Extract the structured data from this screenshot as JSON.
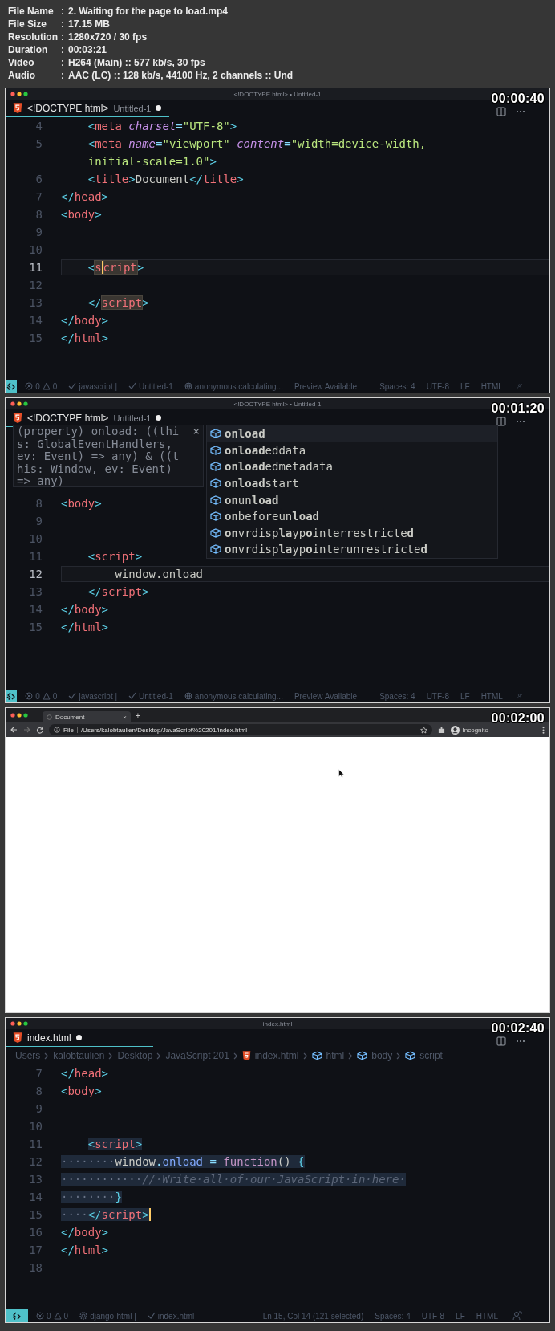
{
  "info": [
    {
      "label": "File Name",
      "sep": ":",
      "value": "2. Waiting for the page to load.mp4"
    },
    {
      "label": "File Size",
      "sep": ":",
      "value": "17.15 MB"
    },
    {
      "label": "Resolution",
      "sep": ":",
      "value": "1280x720 / 30 fps"
    },
    {
      "label": "Duration",
      "sep": ":",
      "value": "00:03:21"
    },
    {
      "label": "Video",
      "sep": ":",
      "value": "H264 (Main) :: 577 kb/s, 30 fps"
    },
    {
      "label": "Audio",
      "sep": ":",
      "value": "AAC (LC) :: 128 kb/s, 44100 Hz, 2 channels :: Und"
    }
  ],
  "frames": [
    {
      "kind": "editor",
      "timestamp": "00:00:40",
      "window_title": "<!DOCTYPE html> • Untitled-1",
      "tab": {
        "label": "<!DOCTYPE html>",
        "description": "Untitled-1",
        "dirty": true
      },
      "lines": [
        {
          "num": "4",
          "tokens": [
            {
              "text": "    <",
              "kind": "p"
            },
            {
              "text": "meta",
              "kind": "tag"
            },
            {
              "text": " charset",
              "kind": "attr"
            },
            {
              "text": "=",
              "kind": "op"
            },
            {
              "text": "\"UTF-8\"",
              "kind": "str"
            },
            {
              "text": ">",
              "kind": "p"
            }
          ]
        },
        {
          "num": "5",
          "tokens": [
            {
              "text": "    <",
              "kind": "p"
            },
            {
              "text": "meta",
              "kind": "tag"
            },
            {
              "text": " name",
              "kind": "attr"
            },
            {
              "text": "=",
              "kind": "op"
            },
            {
              "text": "\"viewport\"",
              "kind": "str"
            },
            {
              "text": " content",
              "kind": "attr"
            },
            {
              "text": "=",
              "kind": "op"
            },
            {
              "text": "\"width=device-width,",
              "kind": "str"
            }
          ]
        },
        {
          "tokens": [
            {
              "text": "    initial-scale=1.0\"",
              "kind": "str"
            },
            {
              "text": ">",
              "kind": "p"
            }
          ]
        },
        {
          "num": "6",
          "tokens": [
            {
              "text": "    <",
              "kind": "p"
            },
            {
              "text": "title",
              "kind": "tag"
            },
            {
              "text": ">",
              "kind": "p"
            },
            {
              "text": "Document",
              "kind": "txt"
            },
            {
              "text": "</",
              "kind": "p"
            },
            {
              "text": "title",
              "kind": "tag"
            },
            {
              "text": ">",
              "kind": "p"
            }
          ]
        },
        {
          "num": "7",
          "tokens": [
            {
              "text": "</",
              "kind": "p"
            },
            {
              "text": "head",
              "kind": "tag"
            },
            {
              "text": ">",
              "kind": "p"
            }
          ]
        },
        {
          "num": "8",
          "tokens": [
            {
              "text": "<",
              "kind": "p"
            },
            {
              "text": "body",
              "kind": "tag"
            },
            {
              "text": ">",
              "kind": "p"
            }
          ]
        },
        {
          "num": "9"
        },
        {
          "num": "10"
        },
        {
          "num": "11",
          "current": true,
          "tokens": [
            {
              "text": "    <",
              "kind": "p"
            },
            {
              "text": "s",
              "kind": "tag",
              "hl": true,
              "caret": true
            },
            {
              "text": "cript",
              "kind": "tag",
              "hl": true
            },
            {
              "text": ">",
              "kind": "p"
            }
          ]
        },
        {
          "num": "12"
        },
        {
          "num": "13",
          "tokens": [
            {
              "text": "    </",
              "kind": "p"
            },
            {
              "text": "script",
              "kind": "tag",
              "hl": true
            },
            {
              "text": ">",
              "kind": "p"
            }
          ]
        },
        {
          "num": "14",
          "tokens": [
            {
              "text": "</",
              "kind": "p"
            },
            {
              "text": "body",
              "kind": "tag"
            },
            {
              "text": ">",
              "kind": "p"
            }
          ]
        },
        {
          "num": "15",
          "tokens": [
            {
              "text": "</",
              "kind": "p"
            },
            {
              "text": "html",
              "kind": "tag"
            },
            {
              "text": ">",
              "kind": "p"
            }
          ]
        }
      ],
      "status_bar": {
        "problems": {
          "errors": "0",
          "warnings": "0"
        },
        "items": [
          {
            "kind": "check",
            "text": "javascript |"
          },
          {
            "kind": "check",
            "text": "Untitled-1"
          },
          {
            "kind": "globe",
            "text": "anonymous calculating..."
          },
          {
            "kind": "plain",
            "text": "Preview Available"
          }
        ],
        "right": [
          "Spaces: 4",
          "UTF-8",
          "LF",
          "HTML"
        ]
      }
    },
    {
      "kind": "editor",
      "timestamp": "00:01:20",
      "window_title": "<!DOCTYPE html> • Untitled-1",
      "tab": {
        "label": "<!DOCTYPE html>",
        "description": "Untitled-1",
        "dirty": true
      },
      "tooltip": {
        "text": "(property) onload: ((this: GlobalEventHandlers, ev: Event) => any) & ((this: Window, ev: Event) => any)",
        "close": "×"
      },
      "suggestions": [
        {
          "label": "**onload**",
          "selected": true
        },
        {
          "label": "**onload**eddata",
          "selected": false
        },
        {
          "label": "**onload**edmetadata",
          "selected": false
        },
        {
          "label": "**onload**start",
          "selected": false
        },
        {
          "label": "**on**un**load**",
          "selected": false
        },
        {
          "label": "**on**beforeun**load**",
          "selected": false
        },
        {
          "label": "**on**vrdisp**la**yp**o**interrestricte**d**",
          "selected": false
        },
        {
          "label": "**on**vrdisp**la**yp**o**interunrestricte**d**",
          "selected": false
        }
      ],
      "lines": [
        {
          "num": "8",
          "tokens": [
            {
              "text": "<",
              "kind": "p"
            },
            {
              "text": "body",
              "kind": "tag"
            },
            {
              "text": ">",
              "kind": "p"
            }
          ]
        },
        {
          "num": "9"
        },
        {
          "num": "10"
        },
        {
          "num": "11",
          "tokens": [
            {
              "text": "    <",
              "kind": "p"
            },
            {
              "text": "script",
              "kind": "tag"
            },
            {
              "text": ">",
              "kind": "p"
            }
          ]
        },
        {
          "num": "12",
          "current": true,
          "tokens": [
            {
              "text": "        window.onload",
              "kind": "txt"
            }
          ]
        },
        {
          "num": "13",
          "tokens": [
            {
              "text": "    </",
              "kind": "p"
            },
            {
              "text": "script",
              "kind": "tag"
            },
            {
              "text": ">",
              "kind": "p"
            }
          ]
        },
        {
          "num": "14",
          "tokens": [
            {
              "text": "</",
              "kind": "p"
            },
            {
              "text": "body",
              "kind": "tag"
            },
            {
              "text": ">",
              "kind": "p"
            }
          ]
        },
        {
          "num": "15",
          "tokens": [
            {
              "text": "</",
              "kind": "p"
            },
            {
              "text": "html",
              "kind": "tag"
            },
            {
              "text": ">",
              "kind": "p"
            }
          ]
        }
      ],
      "status_bar": {
        "problems": {
          "errors": "0",
          "warnings": "0"
        },
        "items": [
          {
            "kind": "check",
            "text": "javascript |"
          },
          {
            "kind": "check",
            "text": "Untitled-1"
          },
          {
            "kind": "globe",
            "text": "anonymous calculating..."
          },
          {
            "kind": "plain",
            "text": "Preview Available"
          }
        ],
        "right": [
          "Spaces: 4",
          "UTF-8",
          "LF",
          "HTML"
        ]
      }
    },
    {
      "kind": "browser",
      "timestamp": "00:02:00",
      "tab": {
        "label": "Document",
        "close": "×"
      },
      "new_tab": "+",
      "scheme": "File",
      "url": "/Users/kalobtaulien/Desktop/JavaScript%20201/index.html",
      "profile": "Incognito"
    },
    {
      "kind": "editor",
      "timestamp": "00:02:40",
      "window_title": "index.html",
      "tab": {
        "label": "index.html",
        "dirty": true
      },
      "breadcrumbs": [
        {
          "label": "Users",
          "kind": "folder"
        },
        {
          "label": "kalobtaulien",
          "kind": "folder"
        },
        {
          "label": "Desktop",
          "kind": "folder"
        },
        {
          "label": "JavaScript 201",
          "kind": "folder"
        },
        {
          "label": "index.html",
          "kind": "file"
        },
        {
          "label": "html",
          "kind": "symbol"
        },
        {
          "label": "body",
          "kind": "symbol"
        },
        {
          "label": "script",
          "kind": "symbol"
        }
      ],
      "lines": [
        {
          "num": "7",
          "tokens": [
            {
              "text": "</",
              "kind": "p"
            },
            {
              "text": "head",
              "kind": "tag"
            },
            {
              "text": ">",
              "kind": "p"
            }
          ]
        },
        {
          "num": "8",
          "tokens": [
            {
              "text": "<",
              "kind": "p"
            },
            {
              "text": "body",
              "kind": "tag"
            },
            {
              "text": ">",
              "kind": "p"
            }
          ]
        },
        {
          "num": "9"
        },
        {
          "num": "10"
        },
        {
          "num": "11",
          "selected": true,
          "tokens": [
            {
              "text": "    <",
              "kind": "p"
            },
            {
              "text": "script",
              "kind": "tag"
            },
            {
              "text": ">",
              "kind": "p"
            }
          ]
        },
        {
          "num": "12",
          "selected": true,
          "tokens": [
            {
              "text": "········",
              "kind": "ws"
            },
            {
              "text": "window",
              "kind": "txt"
            },
            {
              "text": ".",
              "kind": "op"
            },
            {
              "text": "onload",
              "kind": "prop"
            },
            {
              "text": " = ",
              "kind": "op"
            },
            {
              "text": "function",
              "kind": "kw"
            },
            {
              "text": "() ",
              "kind": "txt"
            },
            {
              "text": "{",
              "kind": "p"
            }
          ]
        },
        {
          "num": "13",
          "selected": true,
          "tokens": [
            {
              "text": "············",
              "kind": "ws"
            },
            {
              "text": "//·Write·all·of·our·JavaScript·in·here·",
              "kind": "cm"
            }
          ]
        },
        {
          "num": "14",
          "selected": true,
          "tokens": [
            {
              "text": "········",
              "kind": "ws"
            },
            {
              "text": "}",
              "kind": "p"
            }
          ]
        },
        {
          "num": "15",
          "selected": true,
          "tokens": [
            {
              "text": "····",
              "kind": "ws"
            },
            {
              "text": "</",
              "kind": "p"
            },
            {
              "text": "script",
              "kind": "tag"
            },
            {
              "text": ">",
              "kind": "p",
              "caret": true
            }
          ]
        },
        {
          "num": "16",
          "tokens": [
            {
              "text": "</",
              "kind": "p"
            },
            {
              "text": "body",
              "kind": "tag"
            },
            {
              "text": ">",
              "kind": "p"
            }
          ]
        },
        {
          "num": "17",
          "tokens": [
            {
              "text": "</",
              "kind": "p"
            },
            {
              "text": "html",
              "kind": "tag"
            },
            {
              "text": ">",
              "kind": "p"
            }
          ]
        },
        {
          "num": "18"
        }
      ],
      "status_bar": {
        "problems": {
          "errors": "0",
          "warnings": "0"
        },
        "items": [
          {
            "kind": "gear",
            "text": "django-html |"
          },
          {
            "kind": "check",
            "text": "index.html"
          }
        ],
        "right": [
          "Ln 15, Col 14 (121 selected)",
          "Spaces: 4",
          "UTF-8",
          "LF",
          "HTML"
        ]
      }
    }
  ]
}
